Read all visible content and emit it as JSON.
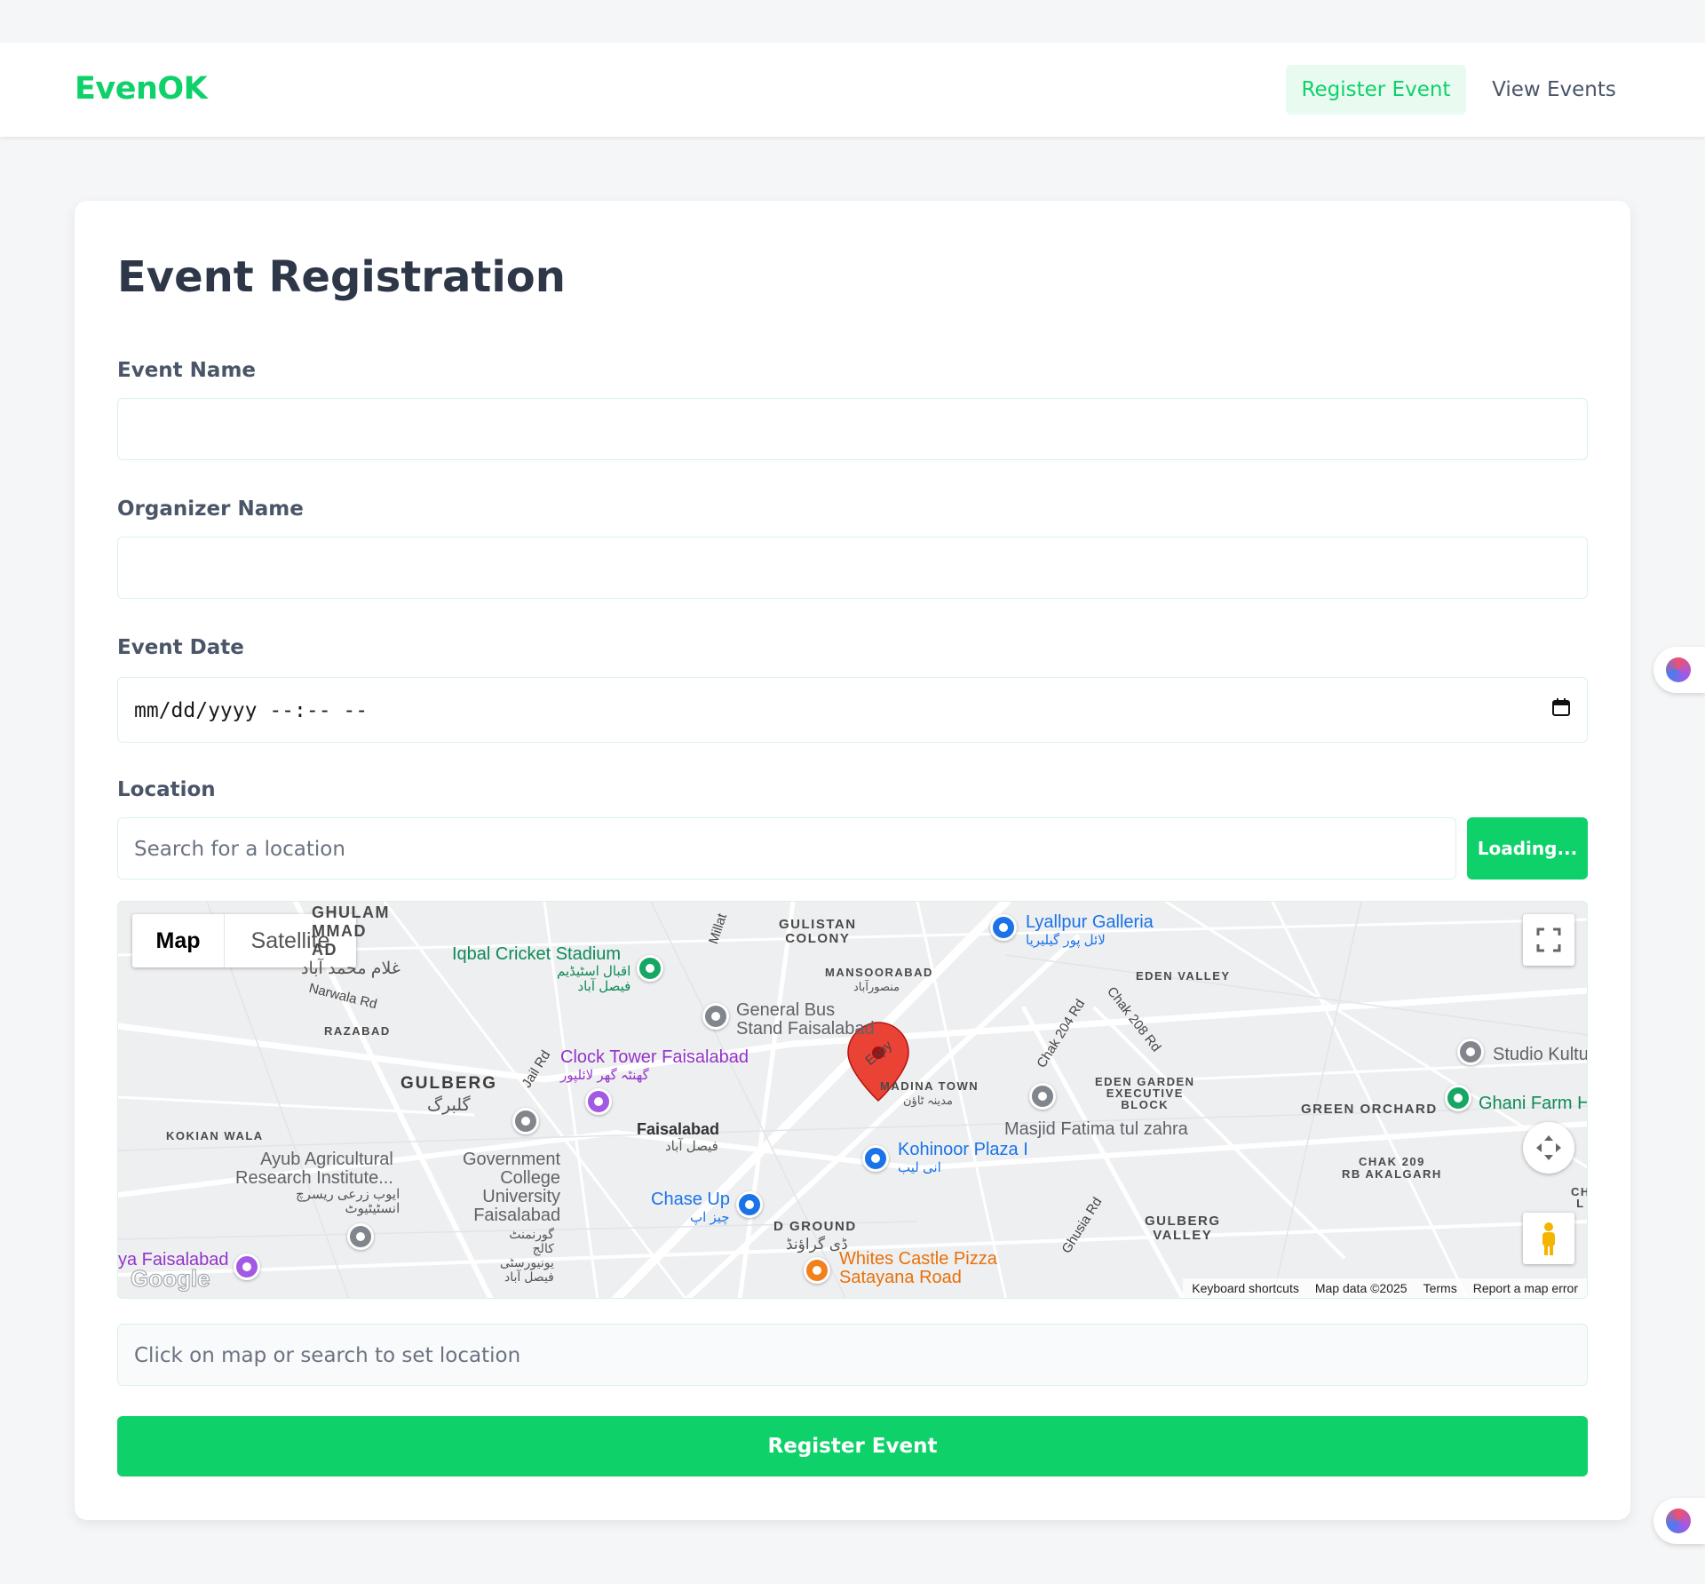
{
  "app": {
    "brand": "EvenOK"
  },
  "nav": {
    "register": "Register Event",
    "view": "View Events"
  },
  "form": {
    "title": "Event Registration",
    "event_name_label": "Event Name",
    "event_name_value": "",
    "organizer_label": "Organizer Name",
    "organizer_value": "",
    "date_label": "Event Date",
    "date_value": "mm/dd/yyyy --:-- --",
    "location_label": "Location",
    "location_placeholder": "Search for a location",
    "search_button": "Loading...",
    "coords_placeholder": "Click on map or search to set location",
    "submit_label": "Register Event"
  },
  "map": {
    "type_map": "Map",
    "type_satellite": "Satellite",
    "labels": {
      "ghulam": "GHULAM\nMMAD\nAD",
      "ghulam_urdu": "غلام محمد آباد",
      "gulistan": "GULISTAN\nCOLONY",
      "mansoorabad": "MANSOORABAD",
      "mansoorabad_urdu": "منصورآباد",
      "eden_valley": "EDEN VALLEY",
      "razabad": "RAZABAD",
      "narwala": "Narwala Rd",
      "millat": "Millat",
      "gulberg": "GULBERG",
      "gulberg_urdu": "گلبرگ",
      "jail_rd": "Jail Rd",
      "madina": "MADINA TOWN",
      "madina_urdu": "مدینہ ٹاؤن",
      "chak204": "Chak 204 Rd",
      "chak208": "Chak 208 Rd",
      "eden_garden": "EDEN GARDEN\nEXECUTIVE\nBLOCK",
      "green_orchard": "GREEN ORCHARD",
      "kokian": "KOKIAN WALA",
      "faisalabad": "Faisalabad",
      "faisalabad_urdu": "فیصل آباد",
      "chak209": "CHAK 209\nRB AKALGARH",
      "d_ground": "D GROUND",
      "d_ground_urdu": "ڈی گراؤنڈ",
      "gulberg_valley": "GULBERG\nVALLEY",
      "ghusia": "Ghusia Rd",
      "expy": "Expy",
      "ch_l": "CH\nL"
    },
    "pois": {
      "iqbal": "Iqbal Cricket Stadium",
      "iqbal_urdu": "اقبال اسٹیڈیم\nفیصل آباد",
      "lyallpur": "Lyallpur Galleria",
      "lyallpur_urdu": "لائل پور گیلیریا",
      "bus": "General Bus\nStand Faisalabad",
      "clock": "Clock Tower Faisalabad",
      "clock_urdu": "گھنٹہ گھر لائلپور",
      "studio": "Studio Kultu",
      "ghani": "Ghani Farm H",
      "masjid": "Masjid Fatima tul zahra",
      "kohinoor": "Kohinoor Plaza I",
      "kohinoor_urdu": "انی لیب",
      "ayub": "Ayub Agricultural\nResearch Institute...",
      "ayub_urdu": "ایوب زرعی ریسرچ\nانسٹیٹیوٹ",
      "gcu": "Government\nCollege\nUniversity\nFaisalabad",
      "gcu_urdu": "گورنمنٹ\nکالج\nیونیورسٹی\nفیصل آباد",
      "chase": "Chase Up",
      "chase_urdu": "چیز اپ",
      "whites": "Whites Castle Pizza\nSatayana Road",
      "ya_fsd": "ya Faisalabad"
    },
    "footer": {
      "shortcuts": "Keyboard shortcuts",
      "data": "Map data ©2025",
      "terms": "Terms",
      "report": "Report a map error"
    },
    "logo": "Google"
  },
  "colors": {
    "accent": "#0fd16a",
    "accent_light": "#e9fbf1",
    "marker": "#ea4335"
  },
  "icons": [
    "calendar-icon",
    "fullscreen-icon",
    "camera-control-icon",
    "pegman-icon",
    "map-marker-icon",
    "brain-extension-icon"
  ]
}
